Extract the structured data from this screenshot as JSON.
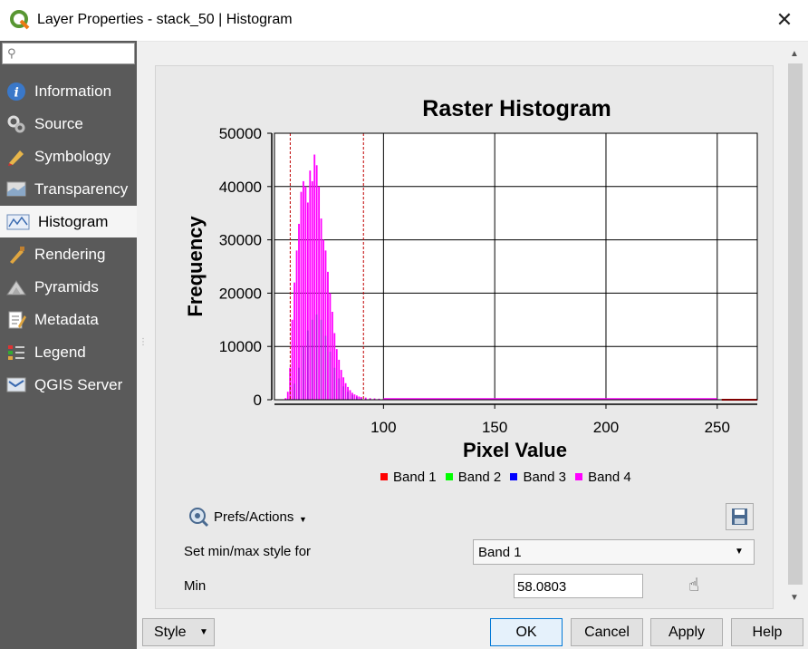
{
  "window": {
    "title": "Layer Properties - stack_50 | Histogram",
    "close_glyph": "✕"
  },
  "sidebar": {
    "search_placeholder": "",
    "items": [
      {
        "label": "Information",
        "icon": "info-icon"
      },
      {
        "label": "Source",
        "icon": "source-icon"
      },
      {
        "label": "Symbology",
        "icon": "symbology-icon"
      },
      {
        "label": "Transparency",
        "icon": "transparency-icon"
      },
      {
        "label": "Histogram",
        "icon": "histogram-icon",
        "active": true
      },
      {
        "label": "Rendering",
        "icon": "rendering-icon"
      },
      {
        "label": "Pyramids",
        "icon": "pyramids-icon"
      },
      {
        "label": "Metadata",
        "icon": "metadata-icon"
      },
      {
        "label": "Legend",
        "icon": "legend-icon"
      },
      {
        "label": "QGIS Server",
        "icon": "server-icon"
      }
    ]
  },
  "chart_data": {
    "type": "bar",
    "title": "Raster Histogram",
    "xlabel": "Pixel Value",
    "ylabel": "Frequency",
    "xlim": [
      51,
      268
    ],
    "ylim": [
      0,
      50000
    ],
    "x_ticks": [
      100,
      150,
      200,
      250
    ],
    "y_ticks": [
      0,
      10000,
      20000,
      30000,
      40000,
      50000
    ],
    "grid": true,
    "min_marker": 58.0803,
    "max_marker": 91,
    "legend_position": "bottom",
    "series": [
      {
        "name": "Band 1",
        "color": "#ff0000"
      },
      {
        "name": "Band 2",
        "color": "#00ff00"
      },
      {
        "name": "Band 3",
        "color": "#0000ff"
      },
      {
        "name": "Band 4",
        "color": "#ff00ff"
      }
    ],
    "band4_x": [
      56,
      57,
      58,
      59,
      60,
      61,
      62,
      63,
      64,
      65,
      66,
      67,
      68,
      69,
      70,
      71,
      72,
      73,
      74,
      75,
      76,
      77,
      78,
      79,
      80,
      81,
      82,
      83,
      84,
      85,
      86,
      87,
      88,
      89,
      90,
      92,
      94,
      96,
      98,
      100,
      104,
      110,
      120
    ],
    "band4_y": [
      300,
      1500,
      6000,
      15000,
      22000,
      28000,
      33000,
      39000,
      41000,
      40000,
      37000,
      43000,
      41000,
      46000,
      44000,
      40000,
      34000,
      30000,
      28000,
      24000,
      20000,
      16500,
      12500,
      9500,
      7500,
      5600,
      4200,
      3100,
      2400,
      1800,
      1300,
      1000,
      800,
      600,
      500,
      400,
      300,
      250,
      200,
      150,
      100,
      60,
      30
    ],
    "band3_x": [
      58,
      60,
      62,
      64,
      66,
      68,
      70,
      72,
      74,
      76,
      78,
      80,
      82,
      84,
      86,
      88,
      90
    ],
    "band3_y": [
      200,
      3000,
      6000,
      10000,
      13000,
      15000,
      16000,
      15000,
      12000,
      9000,
      6000,
      4000,
      2500,
      1500,
      900,
      500,
      300
    ],
    "band1_tail_x": [
      252,
      256,
      260,
      264,
      268
    ],
    "band1_tail_y": [
      0,
      0,
      0,
      0,
      0
    ]
  },
  "controls": {
    "prefs_label": "Prefs/Actions",
    "minmax_label": "Set min/max style for",
    "minmax_value": "Band 1",
    "min_label": "Min",
    "min_value": "58.0803"
  },
  "buttons": {
    "style": "Style",
    "ok": "OK",
    "cancel": "Cancel",
    "apply": "Apply",
    "help": "Help"
  },
  "colors": {
    "sidebar_bg": "#5a5a5a",
    "accent": "#0078d7"
  }
}
